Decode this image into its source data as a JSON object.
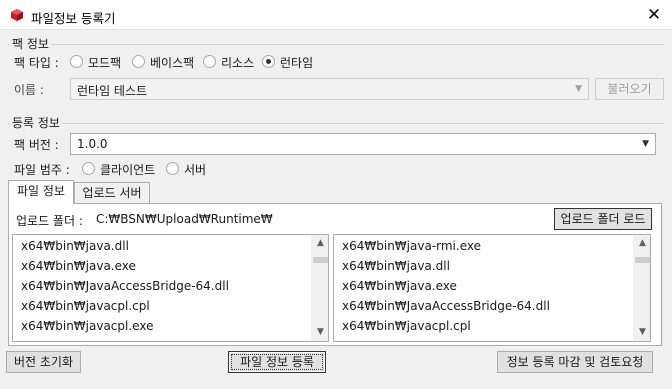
{
  "window": {
    "title": "파일정보 등록기",
    "close": "✕"
  },
  "pack_section": {
    "label": "팩 정보",
    "type_label": "팩 타입 :",
    "types": [
      {
        "label": "모드팩",
        "checked": false
      },
      {
        "label": "베이스팩",
        "checked": false
      },
      {
        "label": "리소스",
        "checked": false
      },
      {
        "label": "런타임",
        "checked": true
      }
    ],
    "name_label": "이름 :",
    "name_value": "런타임 테스트",
    "load_button": "불러오기"
  },
  "register_section": {
    "label": "등록 정보",
    "version_label": "팩 버전 :",
    "version_value": "1.0.0",
    "category_label": "파일 범주 :",
    "categories": [
      {
        "label": "클라이언트",
        "checked": false
      },
      {
        "label": "서버",
        "checked": false
      }
    ]
  },
  "tabs": [
    {
      "label": "파일 정보",
      "active": true
    },
    {
      "label": "업로드 서버",
      "active": false
    }
  ],
  "upload": {
    "folder_label": "업로드 폴더 :",
    "folder_path": "C:₩BSN₩Upload₩Runtime₩",
    "folder_load_button": "업로드 폴더 로드"
  },
  "left_list": [
    "x64₩bin₩java.dll",
    "x64₩bin₩java.exe",
    "x64₩bin₩JavaAccessBridge-64.dll",
    "x64₩bin₩javacpl.cpl",
    "x64₩bin₩javacpl.exe"
  ],
  "right_list": [
    "x64₩bin₩java-rmi.exe",
    "x64₩bin₩java.dll",
    "x64₩bin₩java.exe",
    "x64₩bin₩JavaAccessBridge-64.dll",
    "x64₩bin₩javacpl.cpl"
  ],
  "footer": {
    "reset_version": "버전 초기화",
    "register_file_info": "파일 정보 등록",
    "finish_review": "정보 등록 마감 및 검토요청"
  },
  "icons": {
    "app": "app-cube-icon",
    "dropdown": "chevron-down-icon",
    "scroll_up": "scroll-up-arrow-icon",
    "scroll_down": "scroll-down-arrow-icon"
  },
  "colors": {
    "app_icon": "#c8202a",
    "window_bg": "#f0f0f0"
  }
}
